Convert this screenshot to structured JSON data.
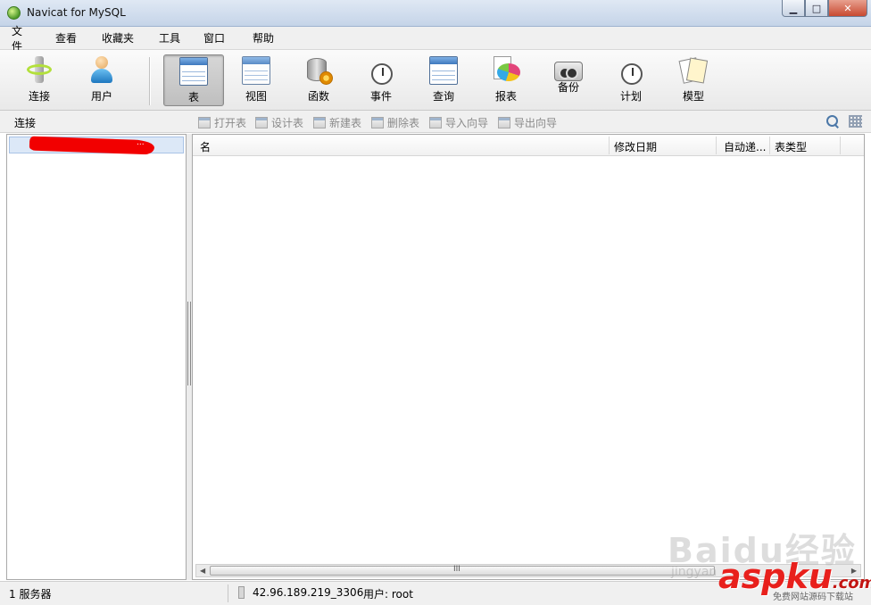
{
  "window": {
    "title": "Navicat for MySQL",
    "min": "▁",
    "max": "□",
    "close": "✕"
  },
  "menu": [
    "文件",
    "查看",
    "收藏夹",
    "工具",
    "窗口",
    "帮助"
  ],
  "toolbar": {
    "connect": "连接",
    "user": "用户",
    "table": "表",
    "view": "视图",
    "function": "函数",
    "event": "事件",
    "query": "查询",
    "report": "报表",
    "backup": "备份",
    "schedule": "计划",
    "model": "模型",
    "active": "table"
  },
  "subbar": {
    "connection_label": "连接",
    "open_table": "打开表",
    "design_table": "设计表",
    "new_table": "新建表",
    "delete_table": "删除表",
    "import_wizard": "导入向导",
    "export_wizard": "导出向导"
  },
  "tree": {
    "connection_label": "..."
  },
  "table": {
    "columns": [
      "名",
      "修改日期",
      "自动递...",
      "表类型"
    ],
    "rows": [],
    "scroll_grip": "III"
  },
  "status": {
    "server_count": "1 服务器",
    "host": "42.96.189.219_3306",
    "user": "用户: root"
  },
  "watermark": {
    "baidu": "Baidu经验",
    "jingyan": "jingyan",
    "aspku": "aspku",
    "aspku_suffix": ".com",
    "sub": "免费网站源码下载站"
  },
  "colors": {
    "accent": "#3e78be",
    "redaction": "#f20000",
    "aspku_red": "#e8201c"
  },
  "icons": [
    "connect-icon",
    "user-icon",
    "table-icon",
    "view-icon",
    "function-icon",
    "event-icon",
    "query-icon",
    "report-icon",
    "backup-icon",
    "schedule-icon",
    "model-icon",
    "search-icon",
    "grid-icon"
  ]
}
